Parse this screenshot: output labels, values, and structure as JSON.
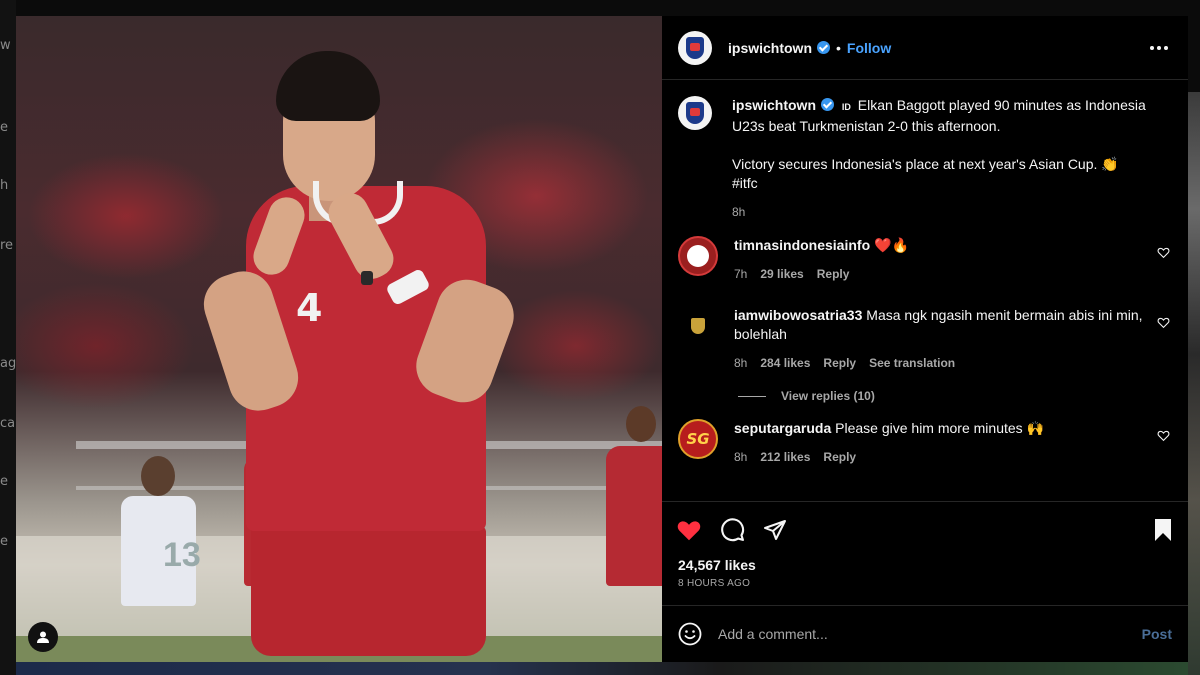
{
  "background": {
    "left_fragments": [
      "w",
      "e",
      "h",
      "re",
      "ag",
      "ca",
      "e",
      "e"
    ]
  },
  "post": {
    "username": "ipswichtown",
    "follow_label": "Follow",
    "caption_flag": "ID",
    "caption_line1": "Elkan Baggott played 90 minutes as Indonesia U23s beat Turkmenistan 2-0 this afternoon.",
    "caption_line2": "Victory secures Indonesia's place at next year's Asian Cup. 👏",
    "caption_hashtag": "#itfc",
    "caption_time": "8h",
    "likes": "24,567 likes",
    "time_ago": "8 HOURS AGO",
    "add_comment_placeholder": "Add a comment...",
    "post_label": "Post"
  },
  "media": {
    "jersey_number": "4",
    "bg_jersey_number": "13"
  },
  "comments": [
    {
      "username": "timnasindonesiainfo",
      "text": "❤️🔥",
      "time": "7h",
      "likes": "29 likes",
      "reply_label": "Reply"
    },
    {
      "username": "iamwibowosatria33",
      "text": "Masa ngk ngasih menit bermain abis ini min, bolehlah",
      "time": "8h",
      "likes": "284 likes",
      "reply_label": "Reply",
      "translation_label": "See translation",
      "view_replies": "View replies (10)"
    },
    {
      "username": "seputargaruda",
      "text": "Please give him more minutes 🙌",
      "time": "8h",
      "likes": "212 likes",
      "reply_label": "Reply",
      "avatar_text": "SG"
    }
  ],
  "colors": {
    "accent_blue": "#4aa3ff",
    "like_red": "#ff3040",
    "verified_blue": "#3897f0"
  },
  "icons": [
    "verified-badge-icon",
    "more-options-icon",
    "heart-icon",
    "comment-icon",
    "share-icon",
    "bookmark-icon",
    "emoji-icon",
    "user-tag-icon"
  ]
}
